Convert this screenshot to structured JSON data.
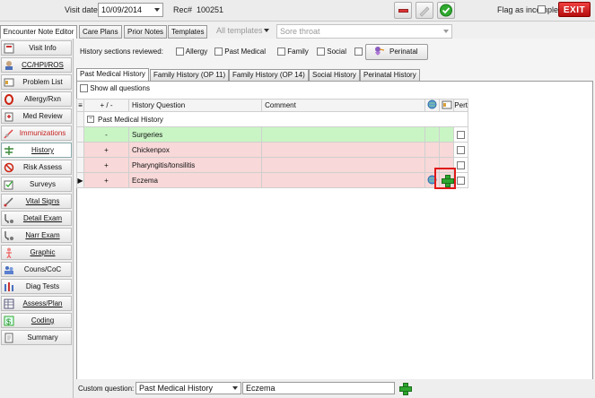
{
  "header": {
    "visit_date_label": "Visit date:",
    "visit_date": "10/09/2014",
    "rec_label": "Rec#",
    "rec_number": "100251",
    "flag_label": "Flag as incomplete",
    "exit_label": "EXIT"
  },
  "top_tabs": [
    {
      "label": "Encounter Note Editor",
      "active": true
    },
    {
      "label": "Care Plans"
    },
    {
      "label": "Prior Notes"
    },
    {
      "label": "Templates"
    }
  ],
  "template_select": {
    "label": "All templates",
    "value": "Sore throat"
  },
  "sidebar": {
    "items": [
      {
        "label": "Visit Info",
        "icon": "visit-info-icon"
      },
      {
        "label": "CC/HPI/ROS",
        "icon": "cc-hpi-ros-icon"
      },
      {
        "label": "Problem List",
        "icon": "problem-list-icon"
      },
      {
        "label": "Allergy/Rxn",
        "icon": "allergy-icon"
      },
      {
        "label": "Med Review",
        "icon": "med-review-icon"
      },
      {
        "label": "Immunizations",
        "icon": "syringe-icon"
      },
      {
        "label": "History",
        "icon": "history-icon",
        "active": true
      },
      {
        "label": "Risk Assess",
        "icon": "risk-assess-icon"
      },
      {
        "label": "Surveys",
        "icon": "surveys-icon"
      },
      {
        "label": "Vital Signs",
        "icon": "vital-signs-icon"
      },
      {
        "label": "Detail Exam",
        "icon": "stethoscope-icon"
      },
      {
        "label": "Narr Exam",
        "icon": "stethoscope-icon"
      },
      {
        "label": "Graphic",
        "icon": "body-figure-icon"
      },
      {
        "label": "Couns/CoC",
        "icon": "counseling-icon"
      },
      {
        "label": "Diag Tests",
        "icon": "diag-tests-icon"
      },
      {
        "label": "Assess/Plan",
        "icon": "assess-plan-icon"
      },
      {
        "label": "Coding",
        "icon": "coding-icon"
      },
      {
        "label": "Summary",
        "icon": "summary-icon"
      }
    ]
  },
  "reviewed": {
    "label": "History sections reviewed:",
    "items": [
      {
        "label": "Allergy"
      },
      {
        "label": "Past Medical"
      },
      {
        "label": "Family"
      },
      {
        "label": "Social"
      },
      {
        "label": ""
      }
    ],
    "perinatal_button": "Perinatal"
  },
  "subtabs": [
    {
      "label": "Past Medical History",
      "active": true
    },
    {
      "label": "Family History (OP 11)"
    },
    {
      "label": "Family History (OP 14)"
    },
    {
      "label": "Social History"
    },
    {
      "label": "Perinatal History"
    }
  ],
  "show_all_label": "Show all questions",
  "grid": {
    "headers": {
      "sign": "+ / -",
      "question": "History Question",
      "comment": "Comment",
      "pert": "Pert"
    },
    "group": "Past Medical History",
    "rows": [
      {
        "sign": "-",
        "question": "Surgeries",
        "comment": "",
        "status": "negative"
      },
      {
        "sign": "+",
        "question": "Chickenpox",
        "comment": "",
        "status": "positive"
      },
      {
        "sign": "+",
        "question": "Pharyngitis/tonsilitis",
        "comment": "",
        "status": "positive"
      },
      {
        "sign": "+",
        "question": "Eczema",
        "comment": "",
        "status": "positive",
        "current": true
      }
    ]
  },
  "custom_question": {
    "label": "Custom question:",
    "category": "Past Medical History",
    "value": "Eczema"
  },
  "colors": {
    "positive_row": "#f8d8d8",
    "negative_row": "#c9f5c4",
    "highlight": "#e01818",
    "exit": "#d21f1f"
  }
}
